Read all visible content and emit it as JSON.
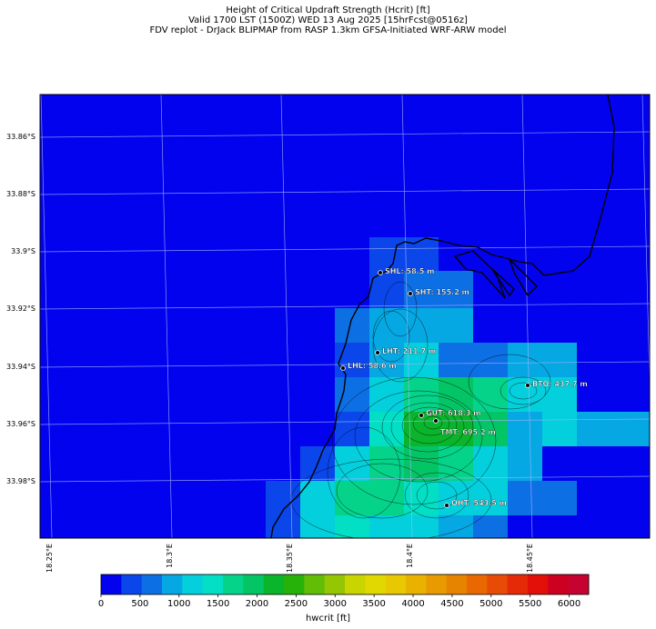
{
  "title": {
    "line1": "Height of Critical Updraft Strength (Hcrit) [ft]",
    "line2": "Valid 1700 LST (1500Z) WED 13 Aug 2025 [15hrFcst@0516z]",
    "line3": "FDV replot - DrJack BLIPMAP from RASP 1.3km GFSA-Initiated WRF-ARW model"
  },
  "map": {
    "lat_labels": [
      "33.86°S",
      "33.88°S",
      "33.9°S",
      "33.92°S",
      "33.94°S",
      "33.96°S",
      "33.98°S"
    ],
    "lon_labels": [
      "18.25°E",
      "18.3°E",
      "18.35°E",
      "18.4°E",
      "18.45°E"
    ],
    "background_color": "#0202ee",
    "stations": [
      {
        "id": "SHL",
        "label": "SHL: 58.5 m"
      },
      {
        "id": "SHT",
        "label": "SHT: 155.2 m"
      },
      {
        "id": "LHT",
        "label": "LHT: 211.7 m"
      },
      {
        "id": "LHL",
        "label": "LHL: 58.6 m"
      },
      {
        "id": "BTO",
        "label": "BTO: 437.7 m"
      },
      {
        "id": "GUT",
        "label": "GUT: 618.3 m"
      },
      {
        "id": "TMT",
        "label": "TMT: 695.2 m"
      },
      {
        "id": "OHT",
        "label": "OHT: 543.5 m"
      }
    ]
  },
  "colorbar": {
    "label": "hwcrit [ft]",
    "ticks": [
      "0",
      "500",
      "1000",
      "1500",
      "2000",
      "2500",
      "3000",
      "3500",
      "4000",
      "4500",
      "5000",
      "5500",
      "6000"
    ],
    "colors": [
      "#0202ee",
      "#0a46ea",
      "#0d6fe4",
      "#05a8e2",
      "#04cfdc",
      "#02dfc4",
      "#05d38a",
      "#04c566",
      "#0ab52c",
      "#27b209",
      "#61bd06",
      "#95c603",
      "#c9d502",
      "#e2d801",
      "#e8c802",
      "#eab200",
      "#e89a00",
      "#e68400",
      "#e96802",
      "#e84b06",
      "#e42a07",
      "#e21008",
      "#cc0020",
      "#c40330"
    ],
    "max": 6250
  },
  "chart_data": {
    "type": "heatmap",
    "title": "Height of Critical Updraft Strength (Hcrit) [ft]",
    "units": "ft",
    "lat_range": [
      "33.85°S",
      "34.0°S"
    ],
    "lon_range": [
      "18.25°E",
      "18.5°E"
    ],
    "cells_hcrit_ft": [
      {
        "lat": "33.917",
        "lon": "18.385",
        "value": 250
      },
      {
        "lat": "33.917",
        "lon": "18.40",
        "value": 250
      },
      {
        "lat": "33.93",
        "lon": "18.36",
        "value": 750
      },
      {
        "lat": "33.93",
        "lon": "18.385",
        "value": 1250
      },
      {
        "lat": "33.93",
        "lon": "18.40",
        "value": 1250
      },
      {
        "lat": "33.945",
        "lon": "18.40",
        "value": 1750
      },
      {
        "lat": "33.95",
        "lon": "18.425",
        "value": 1750
      },
      {
        "lat": "33.955",
        "lon": "18.41",
        "value": 2250
      },
      {
        "lat": "33.96",
        "lon": "18.42",
        "value": 2750
      },
      {
        "lat": "33.97",
        "lon": "18.41",
        "value": 2750
      },
      {
        "lat": "33.975",
        "lon": "18.39",
        "value": 2250
      },
      {
        "lat": "33.985",
        "lon": "18.40",
        "value": 2250
      },
      {
        "lat": "33.99",
        "lon": "18.425",
        "value": 1750
      },
      {
        "lat": "33.995",
        "lon": "18.37",
        "value": 1250
      }
    ]
  }
}
